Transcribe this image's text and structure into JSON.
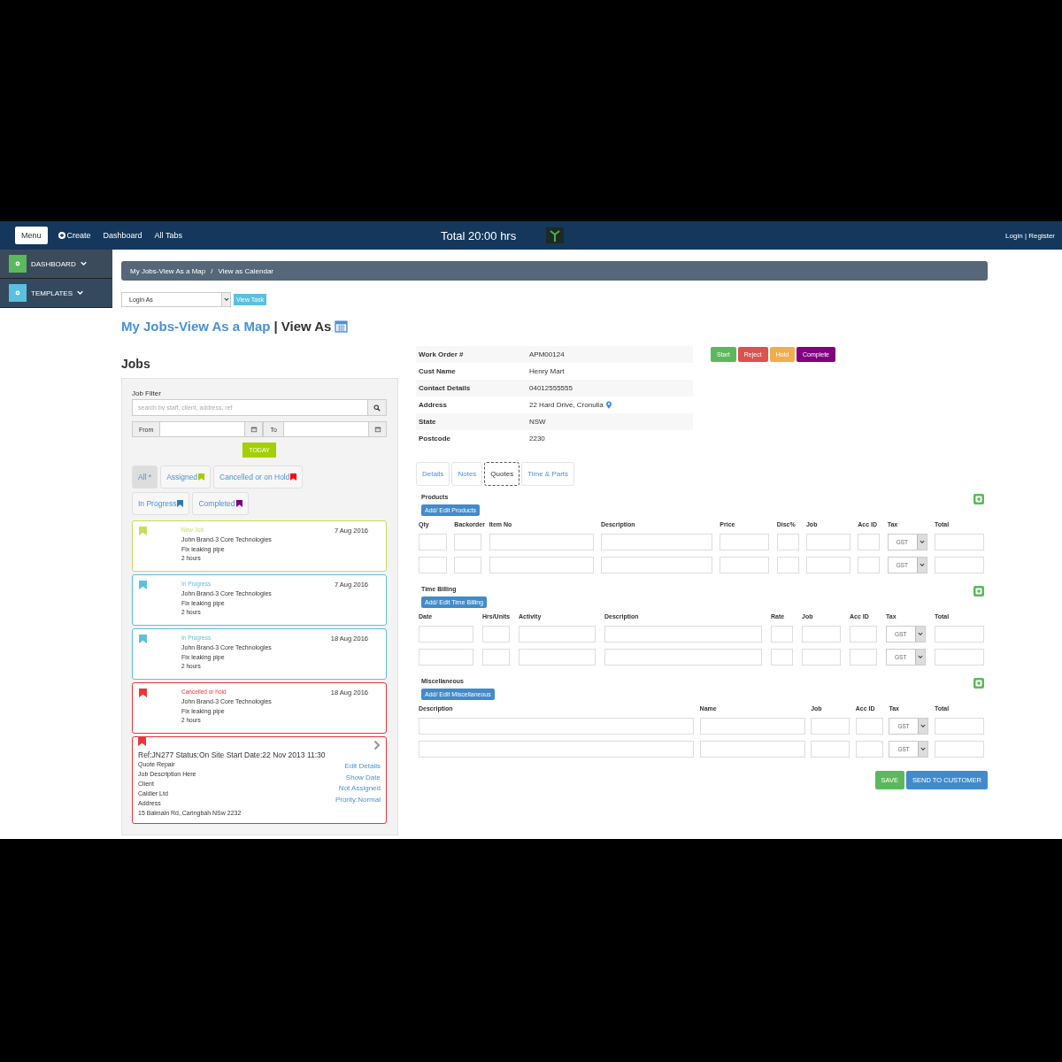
{
  "navbar": {
    "menu_button": "Menu",
    "links": [
      "Create",
      "Dashboard",
      "All Tabs"
    ],
    "total": "Total 20:00 hrs",
    "auth": "Login | Register"
  },
  "sidebar": {
    "items": [
      {
        "label": "DASHBOARD",
        "color": "#5cb85c"
      },
      {
        "label": "TEMPLATES",
        "color": "#5bc0de"
      }
    ]
  },
  "breadcrumb": {
    "items": [
      "My Jobs-View As a Map",
      "View as Calendar"
    ],
    "separator": "/"
  },
  "login_select": {
    "value": "Login As"
  },
  "view_task_button": "View Task",
  "page_title": {
    "link": "My Jobs-View As a Map",
    "separator": "|",
    "rest": "View As"
  },
  "jobs": {
    "heading": "Jobs",
    "filter_label": "Job Filter",
    "search": {
      "placeholder": "search by staff, client, address, ref"
    },
    "from_label": "From",
    "to_label": "To",
    "today_button": "TODAY",
    "chips": [
      {
        "label": "All *",
        "selected": true
      },
      {
        "label": "Assigned",
        "selected": false,
        "color": "#a4cc00"
      },
      {
        "label": "Cancelled or on Hold",
        "selected": false,
        "color": "#ff0000"
      },
      {
        "label": "In Progress",
        "selected": false,
        "color": "#337ab7"
      },
      {
        "label": "Completed",
        "selected": false,
        "color": "#800080"
      }
    ],
    "cards": [
      {
        "kind": "summary",
        "color": "#c9dc5a",
        "status": "New Job",
        "date": "7 Aug 2016",
        "customer": "John Brand-3 Core Technologies",
        "task": "Fix leaking pipe",
        "duration": "2 hours"
      },
      {
        "kind": "summary",
        "color": "#5bc0de",
        "status": "In Progress",
        "date": "7 Aug 2016",
        "customer": "John Brand-3 Core Technologies",
        "task": "Fix leaking pipe",
        "duration": "2 hours"
      },
      {
        "kind": "summary",
        "color": "#5bc0de",
        "status": "In Progress",
        "date": "18 Aug 2016",
        "customer": "John Brand-3 Core Technologies",
        "task": "Fix leaking pipe",
        "duration": "2 hours"
      },
      {
        "kind": "summary",
        "color": "#f0333a",
        "status": "Cancelled or hold",
        "date": "18 Aug 2016",
        "customer": "John Brand-3 Core Technologies",
        "task": "Fix leaking pipe",
        "duration": "2 hours"
      },
      {
        "kind": "detail",
        "color": "#f0333a",
        "ref": "Ref:JN277 Status:On Site Start Date:22 Nov 2013 11:30",
        "lines": [
          "Quote Repair",
          "Job Description Here",
          "Client",
          "Caldier Ltd",
          "Address",
          "15 Balmain Rd, Caringbah NSw 2232"
        ],
        "links": [
          "Edit Details",
          "Show Date",
          "Not Assigned",
          "Prority:Normal"
        ]
      }
    ]
  },
  "work_order": {
    "fields": [
      {
        "label": "Work Order #",
        "value": "APM00124"
      },
      {
        "label": "Cust Name",
        "value": "Henry Mart"
      },
      {
        "label": "Contact Details",
        "value": "04012555555"
      },
      {
        "label": "Address",
        "value": "22 Hard Drive, Cronulla",
        "pin": true
      },
      {
        "label": "State",
        "value": "NSW"
      },
      {
        "label": "Postcode",
        "value": "2230"
      }
    ],
    "actions": [
      {
        "label": "Start",
        "color": "#5cb85c"
      },
      {
        "label": "Reject",
        "color": "#d9534f"
      },
      {
        "label": "Hold",
        "color": "#f0ad4e"
      },
      {
        "label": "Complete",
        "color": "#800080"
      }
    ]
  },
  "tabs": [
    {
      "label": "Details",
      "selected": false
    },
    {
      "label": "Notes",
      "selected": false
    },
    {
      "label": "Quotes",
      "selected": true
    },
    {
      "label": "Time & Parts",
      "selected": false
    }
  ],
  "sections": [
    {
      "title": "Products",
      "button": "Add/ Edit Products",
      "columns": [
        {
          "label": "Qty",
          "kind": "text"
        },
        {
          "label": "Backorder",
          "kind": "text"
        },
        {
          "label": "Item No",
          "kind": "text"
        },
        {
          "label": "Description",
          "kind": "text"
        },
        {
          "label": "Price",
          "kind": "text"
        },
        {
          "label": "Disc%",
          "kind": "text"
        },
        {
          "label": "Job",
          "kind": "text"
        },
        {
          "label": "Acc ID",
          "kind": "text"
        },
        {
          "label": "Tax",
          "kind": "select"
        },
        {
          "label": "Total",
          "kind": "text"
        }
      ],
      "rows": [
        {
          "tax": "GST"
        },
        {
          "tax": "GST"
        }
      ]
    },
    {
      "title": "Time Billing",
      "button": "Add/ Edit Time Billing",
      "columns": [
        {
          "label": "Date",
          "kind": "text"
        },
        {
          "label": "Hrs/Units",
          "kind": "text"
        },
        {
          "label": "Activity",
          "kind": "text"
        },
        {
          "label": "Description",
          "kind": "text"
        },
        {
          "label": "Rate",
          "kind": "text"
        },
        {
          "label": "Job",
          "kind": "text"
        },
        {
          "label": "Acc ID",
          "kind": "text"
        },
        {
          "label": "Tax",
          "kind": "select"
        },
        {
          "label": "Total",
          "kind": "text"
        }
      ],
      "rows": [
        {
          "tax": "GST"
        },
        {
          "tax": "GST"
        }
      ]
    },
    {
      "title": "Miscellaneous",
      "button": "Add/ Edit Miscellaneous",
      "columns": [
        {
          "label": "Description",
          "kind": "text"
        },
        {
          "label": "Name",
          "kind": "text"
        },
        {
          "label": "Job",
          "kind": "text"
        },
        {
          "label": "Acc ID",
          "kind": "text"
        },
        {
          "label": "Tax",
          "kind": "select"
        },
        {
          "label": "Total",
          "kind": "text"
        }
      ],
      "rows": [
        {
          "tax": "GST"
        },
        {
          "tax": "GST"
        }
      ]
    }
  ],
  "footer_buttons": [
    {
      "label": "SAVE",
      "kind": "save"
    },
    {
      "label": "SEND TO CUSTOMER",
      "kind": "send"
    }
  ]
}
